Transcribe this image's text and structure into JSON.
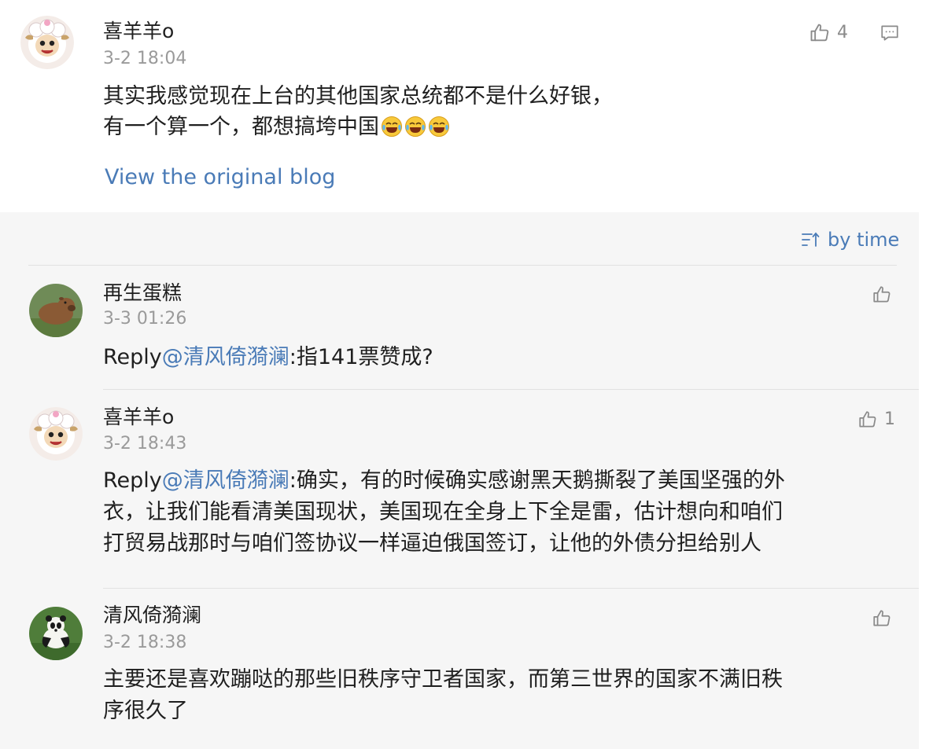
{
  "post": {
    "username": "喜羊羊o",
    "timestamp": "3-2 18:04",
    "like_count": "4",
    "text_line1": "其实我感觉现在上台的其他国家总统都不是什么好银，",
    "text_line2": "有一个算一个，都想搞垮中国",
    "emojis": [
      "laughing-crying-emoji",
      "laughing-crying-emoji",
      "laughing-crying-emoji"
    ],
    "view_original_label": "View the original blog"
  },
  "sort": {
    "label": "by time",
    "icon": "sort-icon"
  },
  "comments": [
    {
      "username": "再生蛋糕",
      "timestamp": "3-3 01:26",
      "reply_prefix": "Reply",
      "mention": "@清风倚漪澜",
      "text": ":指141票赞成?",
      "like_count": ""
    },
    {
      "username": "喜羊羊o",
      "timestamp": "3-2 18:43",
      "reply_prefix": "Reply",
      "mention": "@清风倚漪澜",
      "text_line1": ":确实，有的时候确实感谢黑天鹅撕裂了美国坚强的外",
      "text_line2": "衣，让我们能看清美国现状，美国现在全身上下全是雷，估计想向和咱们",
      "text_line3": "打贸易战那时与咱们签协议一样逼迫俄国签订，让他的外债分担给别人",
      "like_count": "1"
    },
    {
      "username": "清风倚漪澜",
      "timestamp": "3-2 18:38",
      "text_line1": "主要还是喜欢蹦哒的那些旧秩序守卫者国家，而第三世界的国家不满旧秩",
      "text_line2": "序很久了",
      "like_count": ""
    }
  ],
  "icons": {
    "like": "thumbs-up-icon",
    "comment": "comment-icon"
  },
  "colors": {
    "link": "#4a7bb7",
    "muted": "#9a9a9a",
    "thread_bg": "#f6f6f6"
  }
}
